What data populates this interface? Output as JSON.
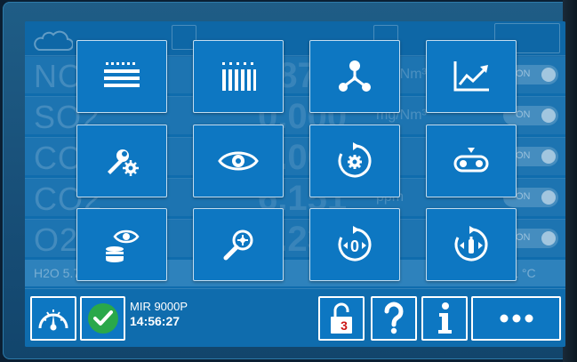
{
  "background": {
    "rows": [
      {
        "label": "NOx",
        "value": "987.5",
        "unit": "mg/Nm³"
      },
      {
        "label": "SO2",
        "value": "0.000",
        "unit": "mg/Nm³"
      },
      {
        "label": "CO",
        "value": "0.000",
        "unit": ""
      },
      {
        "label": "CO2",
        "value": "6.151",
        "unit": "ppm"
      },
      {
        "label": "O2",
        "value": "6.235",
        "unit": ""
      }
    ],
    "toggle_label": "ON",
    "footer": {
      "h2o": "H2O 5.798",
      "temp": "473.1 °C"
    }
  },
  "menu": {
    "tiles": [
      {
        "icon": "list-icon"
      },
      {
        "icon": "columns-icon"
      },
      {
        "icon": "network-icon"
      },
      {
        "icon": "trend-chart-icon"
      },
      {
        "icon": "maintenance-tools-icon"
      },
      {
        "icon": "eye-icon"
      },
      {
        "icon": "gear-cycle-icon"
      },
      {
        "icon": "conveyor-icon"
      },
      {
        "icon": "eye-database-icon"
      },
      {
        "icon": "magnifier-icon"
      },
      {
        "icon": "zero-calibration-icon"
      },
      {
        "icon": "span-calibration-icon"
      }
    ]
  },
  "status": {
    "device_name": "MIR 9000P",
    "time": "14:56:27",
    "lock_number": "3"
  },
  "colors": {
    "screen_bg": "#0f6cad",
    "tile_bg": "#0d77c2",
    "ok_green": "#2aa84a",
    "lock_red": "#cc1414"
  }
}
